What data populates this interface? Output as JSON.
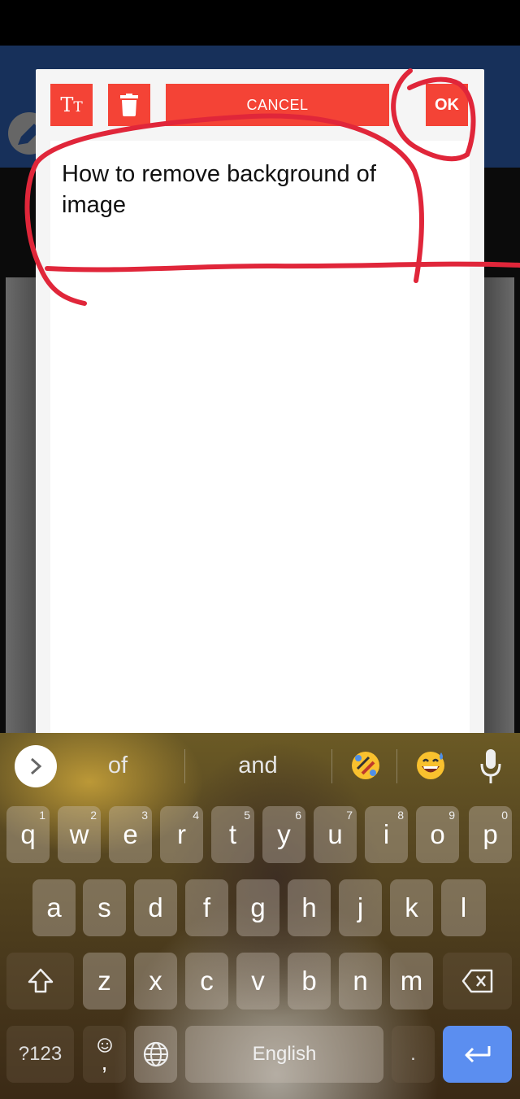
{
  "dialog": {
    "toolbar": {
      "font_button_icon": "text-size-icon",
      "font_glyph_big": "T",
      "font_glyph_small": "T",
      "delete_button_icon": "trash-icon",
      "cancel_label": "CANCEL",
      "ok_label": "OK"
    },
    "text_value_line1": "How to remove background of",
    "text_value_line2": "image",
    "accent_color": "#f44336"
  },
  "background": {
    "app_bar_color": "#17305a",
    "fab_icon": "pencil-icon"
  },
  "annotations": {
    "description": "Red hand-drawn circles around the text field and the OK button",
    "color": "#e0263a"
  },
  "keyboard": {
    "suggestions": [
      "of",
      "and"
    ],
    "emoji_suggestions": [
      "rolling-on-floor-laughing",
      "grinning-sweat"
    ],
    "expand_icon": "chevron-right-icon",
    "mic_icon": "microphone-icon",
    "row1": [
      {
        "key": "q",
        "hint": "1"
      },
      {
        "key": "w",
        "hint": "2"
      },
      {
        "key": "e",
        "hint": "3"
      },
      {
        "key": "r",
        "hint": "4"
      },
      {
        "key": "t",
        "hint": "5"
      },
      {
        "key": "y",
        "hint": "6"
      },
      {
        "key": "u",
        "hint": "7"
      },
      {
        "key": "i",
        "hint": "8"
      },
      {
        "key": "o",
        "hint": "9"
      },
      {
        "key": "p",
        "hint": "0"
      }
    ],
    "row2": [
      "a",
      "s",
      "d",
      "f",
      "g",
      "h",
      "j",
      "k",
      "l"
    ],
    "row3": [
      "z",
      "x",
      "c",
      "v",
      "b",
      "n",
      "m"
    ],
    "symbols_label": "?123",
    "comma_label": ",",
    "space_label": "English",
    "period_label": ".",
    "enter_color": "#5b8ef0"
  }
}
